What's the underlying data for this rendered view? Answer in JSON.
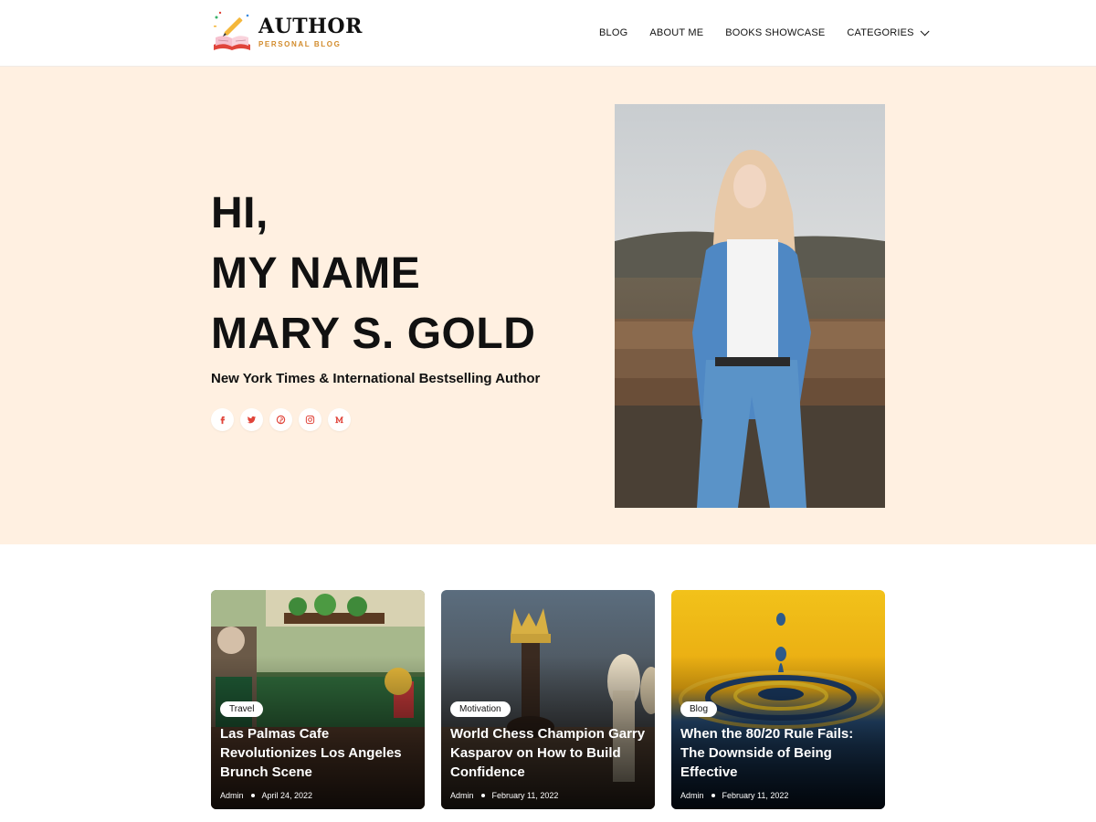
{
  "header": {
    "logo_title": "AUTHOR",
    "logo_subtitle": "PERSONAL BLOG",
    "nav": [
      {
        "label": "BLOG"
      },
      {
        "label": "ABOUT ME"
      },
      {
        "label": "BOOKS SHOWCASE"
      },
      {
        "label": "CATEGORIES",
        "has_dropdown": true
      }
    ]
  },
  "hero": {
    "lines": [
      "HI,",
      "MY NAME",
      "MARY S. GOLD"
    ],
    "subtitle": "New York Times & International Bestselling Author",
    "background": "#fff0e1",
    "social_icons": [
      "facebook-icon",
      "twitter-icon",
      "pinterest-icon",
      "instagram-icon",
      "medium-icon"
    ],
    "social_color": "#e0443a"
  },
  "posts": [
    {
      "category": "Travel",
      "title": "Las Palmas Cafe Revolutionizes Los Angeles Brunch Scene",
      "author": "Admin",
      "date": "April 24, 2022"
    },
    {
      "category": "Motivation",
      "title": "World Chess Champion Garry Kasparov on How to Build Confidence",
      "author": "Admin",
      "date": "February 11, 2022"
    },
    {
      "category": "Blog",
      "title": "When the 80/20 Rule Fails: The Downside of Being Effective",
      "author": "Admin",
      "date": "February 11, 2022"
    }
  ]
}
